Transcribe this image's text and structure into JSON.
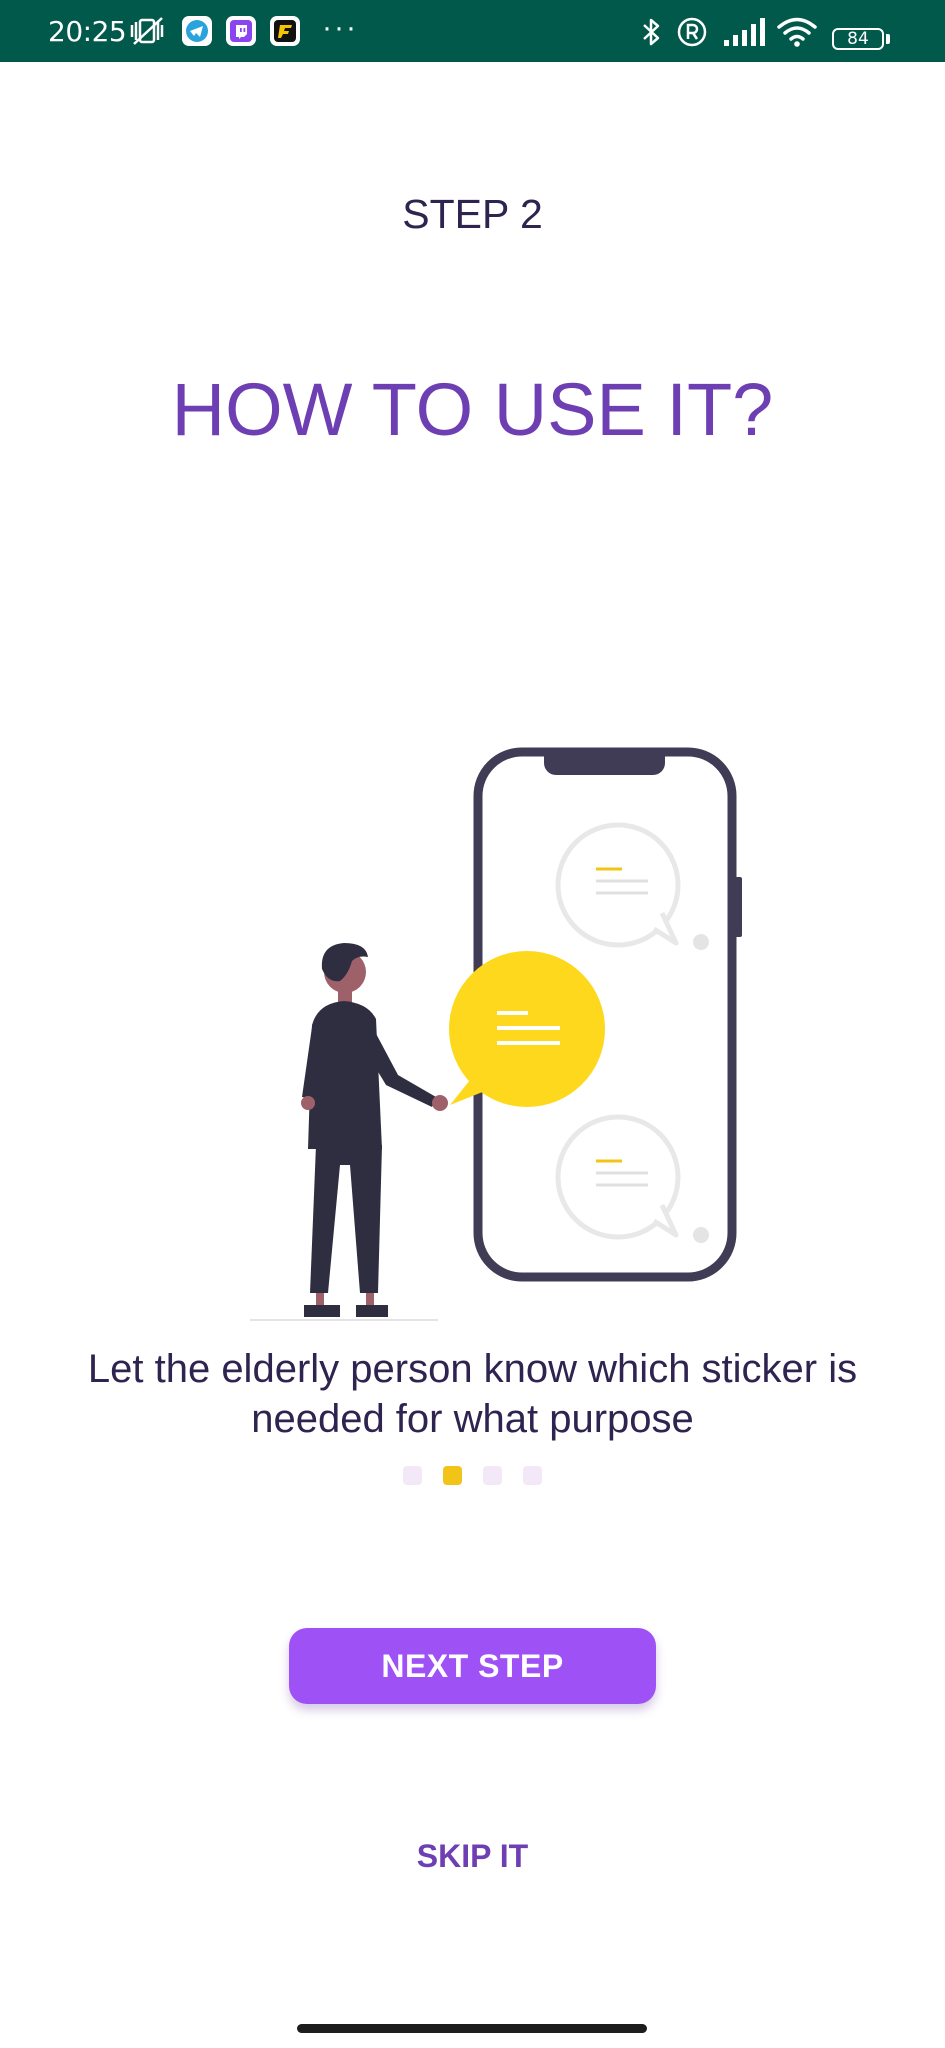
{
  "status_bar": {
    "time": "20:25",
    "battery": "84",
    "more": "···",
    "colors": {
      "background": "#00594a",
      "foreground": "#ffffff"
    },
    "icons": [
      "vibrate-off-icon",
      "telegram-icon",
      "twitch-icon",
      "app-notification-icon",
      "bluetooth-icon",
      "registered-icon",
      "signal-icon",
      "wifi-icon",
      "battery-icon"
    ]
  },
  "onboarding": {
    "step_label": "STEP 2",
    "title": "HOW TO USE IT?",
    "description": "Let the elderly person know which sticker is needed for what purpose",
    "pager": {
      "total": 4,
      "active_index": 1
    },
    "next_button": "NEXT STEP",
    "skip_link": "SKIP IT"
  },
  "colors": {
    "title": "#6d3fb2",
    "text": "#2f2350",
    "button": "#9e52f5",
    "accent": "#f2c418",
    "inactive_dot": "#f2e8f7"
  }
}
